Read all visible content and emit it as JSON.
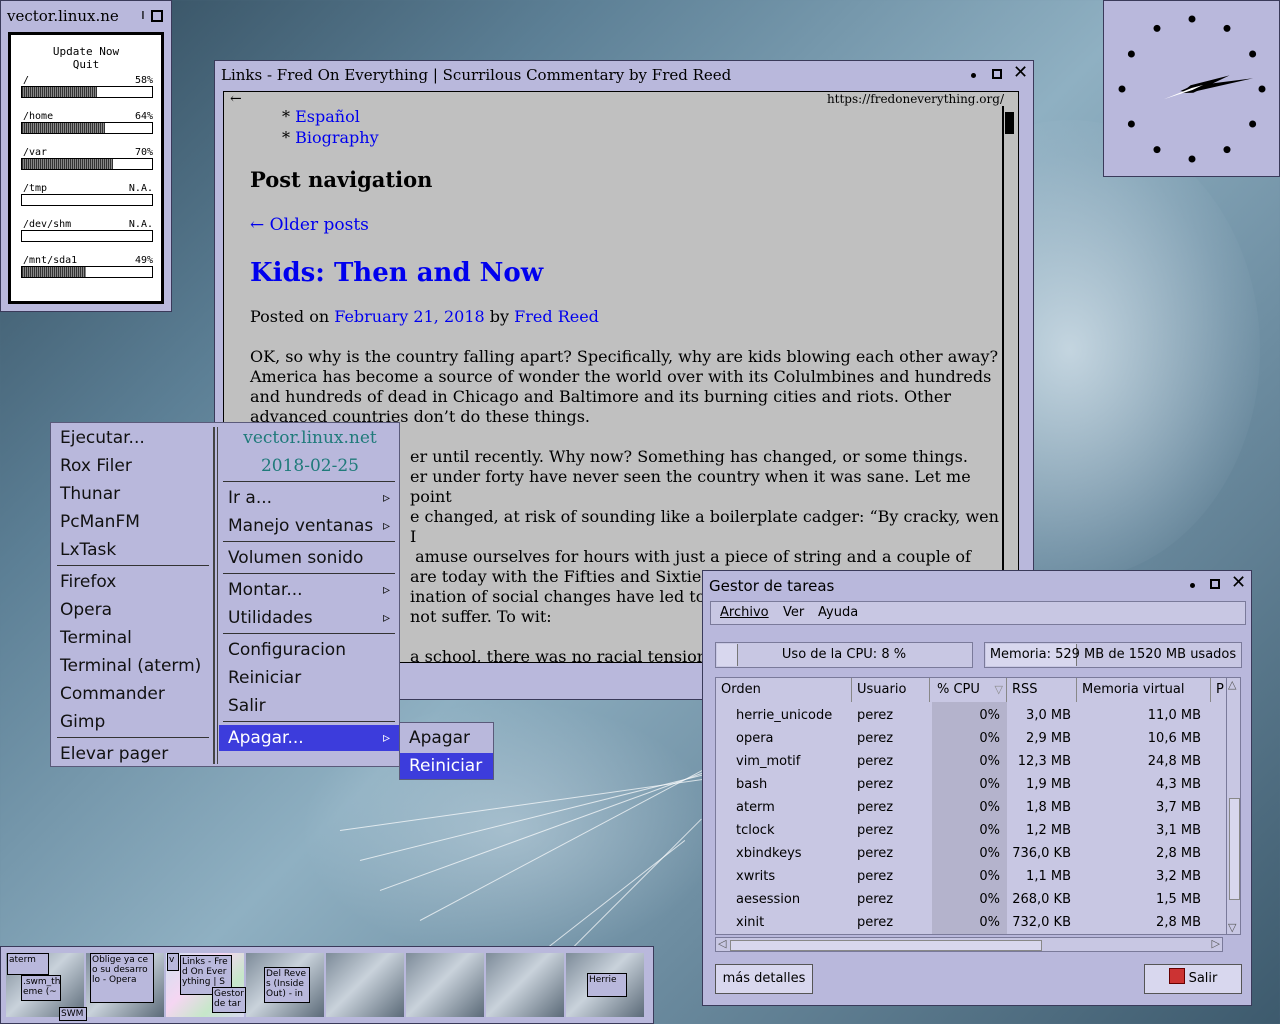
{
  "disk_monitor": {
    "title": "vector.linux.ne",
    "title_extra": "ı",
    "menu": [
      "Update Now",
      "Quit"
    ],
    "mounts": [
      {
        "name": "/",
        "value": "58%",
        "fraction": 0.58
      },
      {
        "name": "/home",
        "value": "64%",
        "fraction": 0.64
      },
      {
        "name": "/var",
        "value": "70%",
        "fraction": 0.7
      },
      {
        "name": "/tmp",
        "value": "N.A.",
        "fraction": 0
      },
      {
        "name": "/dev/shm",
        "value": "N.A.",
        "fraction": 0
      },
      {
        "name": "/mnt/sda1",
        "value": "49%",
        "fraction": 0.49
      }
    ]
  },
  "browser": {
    "title": "Links - Fred On Everything | Scurrilous Commentary by Fred Reed",
    "back": "←",
    "url": "https://fredoneverything.org/",
    "list_items": [
      "Español",
      "Biography"
    ],
    "bullet": "*",
    "post_nav_heading": "Post navigation",
    "older_posts": "← Older posts",
    "post_title": "Kids: Then and Now",
    "posted_on": "Posted on",
    "date": "February 21, 2018",
    "by": "by",
    "author": "Fred Reed",
    "p1": "OK, so why is the country falling apart? Specifically, why are kids blowing each other away? America has become a source of wonder the world over with its Colulmbines and hundreds and hundreds of dead in Chicago and Baltimore and its burning cities and riots. Other advanced countries don’t do these things.",
    "p2_lines": [
      "er until recently.   Why now? Something has changed, or some things.",
      "er under forty have never seen the country when it was sane. Let me point",
      "e changed, at risk of sounding like a boilerplate cadger: “By cracky, wen I",
      " amuse ourselves for hours with just a piece of string and a couple of",
      "are today with the Fifties and Sixties. I mean this as sociology, not"
    ],
    "p3_lines": [
      "ination of social changes have led to tre",
      "not suffer. To wit:"
    ],
    "p4": "a school, there was no racial tension. W"
  },
  "menu": {
    "left_items": [
      "Ejecutar...",
      "Rox Filer",
      "Thunar",
      "PcManFM",
      "LxTask",
      "Firefox",
      "Opera",
      "Terminal",
      "Terminal (aterm)",
      "Commander",
      "Gimp",
      "Elevar pager"
    ],
    "hostname": "vector.linux.net",
    "date": "2018-02-25",
    "right_items": [
      "Ir a...",
      "Manejo ventanas",
      "Volumen sonido",
      "Montar...",
      "Utilidades",
      "Configuracion",
      "Reiniciar",
      "Salir",
      "Apagar..."
    ],
    "submenu": [
      "Apagar",
      "Reiniciar"
    ]
  },
  "task_manager": {
    "title": "Gestor de tareas",
    "menubar": [
      "Archivo",
      "Ver",
      "Ayuda"
    ],
    "cpu_label": "Uso de la CPU: 8 %",
    "cpu_fraction": 0.08,
    "mem_label": "Memoria: 529 MB de 1520 MB usados",
    "mem_fraction": 0.35,
    "columns": [
      "Orden",
      "Usuario",
      "% CPU",
      "RSS",
      "Memoria virtual",
      "P"
    ],
    "sort_indicator": "▽",
    "rows": [
      [
        "herrie_unicode",
        "perez",
        "0%",
        "3,0 MB",
        "11,0 MB"
      ],
      [
        "opera",
        "perez",
        "0%",
        "2,9 MB",
        "10,6 MB"
      ],
      [
        "vim_motif",
        "perez",
        "0%",
        "12,3 MB",
        "24,8 MB"
      ],
      [
        "bash",
        "perez",
        "0%",
        "1,9 MB",
        "4,3 MB"
      ],
      [
        "aterm",
        "perez",
        "0%",
        "1,8 MB",
        "3,7 MB"
      ],
      [
        "tclock",
        "perez",
        "0%",
        "1,2 MB",
        "3,1 MB"
      ],
      [
        "xbindkeys",
        "perez",
        "0%",
        "736,0 KB",
        "2,8 MB"
      ],
      [
        "xwrits",
        "perez",
        "0%",
        "1,1 MB",
        "3,2 MB"
      ],
      [
        "aesession",
        "perez",
        "0%",
        "268,0 KB",
        "1,5 MB"
      ],
      [
        "xinit",
        "perez",
        "0%",
        "732,0 KB",
        "2,8 MB"
      ]
    ],
    "more_details": "más detalles",
    "quit": "Salir",
    "up_arrow": "△",
    "down_arrow": "▽",
    "left_arrow": "◁",
    "right_arrow": "▷"
  },
  "pager": {
    "windows": [
      {
        "text": "aterm"
      },
      {
        "text": ".swm_th eme (~"
      },
      {
        "text": "SWM"
      },
      {
        "text": "Oblige ya ce o su desarro lo - Opera"
      },
      {
        "text": "v"
      },
      {
        "text": "Links - Fre d On Ever ything | S"
      },
      {
        "text": "Gestor de tar"
      },
      {
        "text": "Del Reve s (Inside Out) - in"
      },
      {
        "text": "Herrie"
      }
    ]
  },
  "clock": {
    "hour_angle": -20,
    "minute_angle": -10
  }
}
